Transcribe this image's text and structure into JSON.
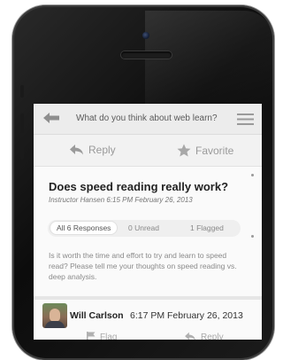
{
  "topbar": {
    "title": "What do you think about web learn?",
    "back_icon": "back-arrow-icon",
    "menu_icon": "hamburger-menu-icon"
  },
  "actions": {
    "reply_label": "Reply",
    "favorite_label": "Favorite"
  },
  "question": {
    "title": "Does speed reading really work?",
    "meta": "Instructor Hansen  6:15 PM  February 26, 2013",
    "body": "Is it worth the time and effort to try and learn to speed read? Please tell me your thoughts on speed reading vs. deep analysis."
  },
  "filters": [
    {
      "label": "All 6 Responses",
      "active": true
    },
    {
      "label": "0 Unread",
      "active": false
    },
    {
      "label": "1 Flagged",
      "active": false
    }
  ],
  "reply": {
    "author": "Will Carlson",
    "timestamp": "6:17 PM February 26, 2013",
    "flag_label": "Flag",
    "reply_label": "Reply"
  },
  "colors": {
    "phone_body": "#111111",
    "screen_background": "#f4f4f4",
    "text_primary": "#222222",
    "text_muted": "#9a9a9a"
  }
}
